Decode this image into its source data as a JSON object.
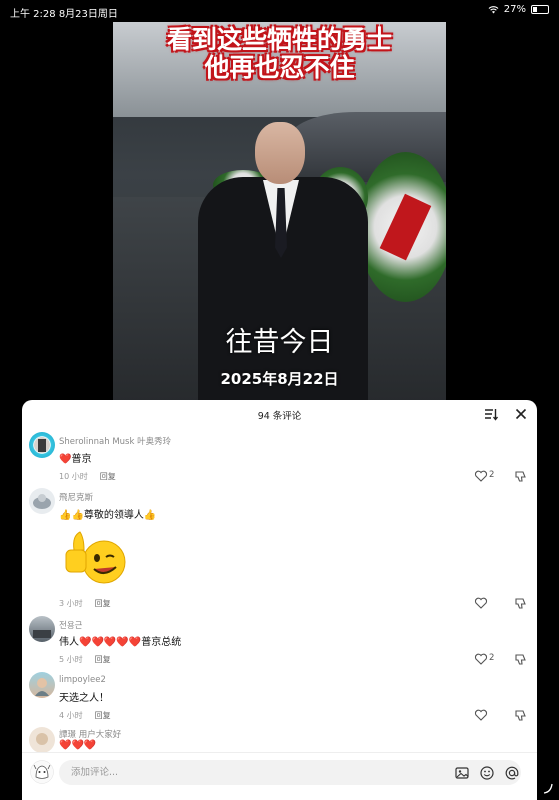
{
  "status_bar": {
    "time_date": "上午 2:28  8月23日周日",
    "battery": "27%",
    "battery_level": 0.27
  },
  "video": {
    "caption_top_line1": "看到这些牺牲的勇士",
    "caption_top_line2": "他再也忍不住",
    "caption_mid": "往昔今日",
    "caption_date": "2025年8月22日"
  },
  "comments_panel": {
    "title": "94 条评论",
    "icons": {
      "sort": "sort-icon",
      "close": "close-icon"
    },
    "comments": [
      {
        "author": "Sherolinnah Musk 叶奥秀玲",
        "text": "普京",
        "lead_hearts": "❤️",
        "trail_hearts": "",
        "tail_text": "",
        "time": "10 小时",
        "reply": "回复",
        "likes": "2"
      },
      {
        "author": "飛尼克斯",
        "text": "👍👍尊敬的领導人👍",
        "lead_hearts": "",
        "trail_hearts": "",
        "tail_text": "",
        "time": "3 小时",
        "reply": "回复",
        "likes": ""
      },
      {
        "author": "전용근",
        "text": "伟人",
        "lead_hearts": "",
        "trail_hearts": "❤️❤️❤️❤️❤️",
        "tail_text": "普京总统",
        "time": "5 小时",
        "reply": "回复",
        "likes": "2"
      },
      {
        "author": "limpoylee2",
        "text": "天选之人！",
        "lead_hearts": "",
        "trail_hearts": "",
        "tail_text": "",
        "time": "4 小时",
        "reply": "回复",
        "likes": ""
      },
      {
        "author": "譚璟 用户大家好",
        "text": "",
        "lead_hearts": "❤️❤️❤️",
        "trail_hearts": "",
        "tail_text": "",
        "time": "",
        "reply": "",
        "likes": ""
      }
    ]
  },
  "input_bar": {
    "placeholder": "添加评论...",
    "icons": [
      "image-icon",
      "emoji-icon",
      "at-icon"
    ]
  },
  "colors": {
    "background": "#000000",
    "panel": "#ffffff",
    "caption_outline": "#c2141a",
    "heart_red": "#e22a2f"
  }
}
